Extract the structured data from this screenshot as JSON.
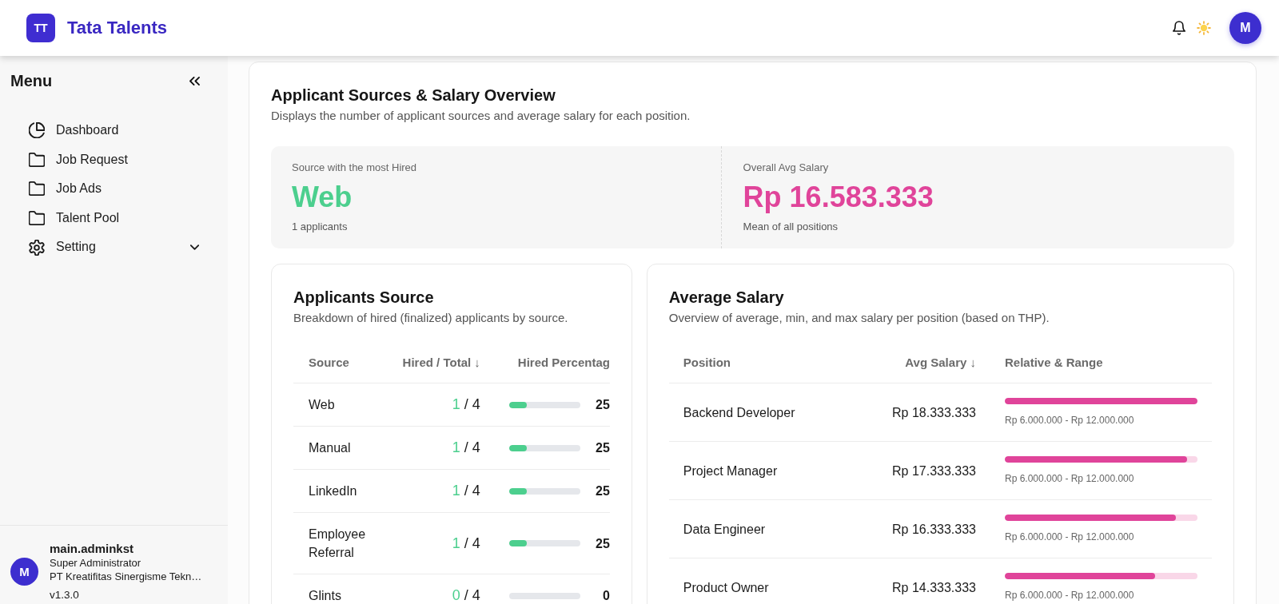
{
  "header": {
    "logo_text": "TT",
    "app_name": "Tata Talents",
    "avatar_initial": "M"
  },
  "sidebar": {
    "title": "Menu",
    "items": [
      {
        "label": "Dashboard",
        "kind": "overview",
        "selected": false
      },
      {
        "label": "Job Request",
        "kind": "page",
        "selected": false
      },
      {
        "label": "Job Ads",
        "kind": "page",
        "selected": false
      },
      {
        "label": "Talent Pool",
        "kind": "page",
        "selected": false
      },
      {
        "label": "Setting",
        "kind": "group",
        "selected": false,
        "expanded": false
      }
    ],
    "user": {
      "avatar_initial": "M",
      "name": "main.adminkst",
      "role": "Super Administrator",
      "company": "PT Kreatifitas Sinergisme Tekn…",
      "version": "v1.3.0"
    }
  },
  "overview": {
    "title": "Applicant Sources & Salary Overview",
    "subtitle": "Displays the number of applicant sources and average salary for each position.",
    "stats": [
      {
        "label": "Source with the most Hired",
        "value": "Web",
        "note": "1 applicants",
        "color": "#4ccf8e"
      },
      {
        "label": "Overall Avg Salary",
        "value": "Rp 16.583.333",
        "note": "Mean of all positions",
        "color": "#e0449a"
      }
    ]
  },
  "applicants_source": {
    "title": "Applicants Source",
    "subtitle": "Breakdown of hired (finalized) applicants by source.",
    "columns": [
      "Source",
      "Hired / Total ↓",
      "Hired Percentag"
    ],
    "rows": [
      {
        "source": "Web",
        "hired": "1",
        "total": "/ 4",
        "level": 0.25,
        "percentage": "25"
      },
      {
        "source": "Manual",
        "hired": "1",
        "total": "/ 4",
        "level": 0.25,
        "percentage": "25"
      },
      {
        "source": "LinkedIn",
        "hired": "1",
        "total": "/ 4",
        "level": 0.25,
        "percentage": "25"
      },
      {
        "source": "Employee Referral",
        "hired": "1",
        "total": "/ 4",
        "level": 0.25,
        "percentage": "25"
      },
      {
        "source": "Glints",
        "hired": "0",
        "total": "/ 4",
        "level": 0,
        "percentage": "0"
      }
    ]
  },
  "average_salary": {
    "title": "Average Salary",
    "subtitle": "Overview of average, min, and max salary per position (based on THP).",
    "columns": [
      "Position",
      "Avg Salary ↓",
      "Relative & Range"
    ],
    "rows": [
      {
        "position": "Backend Developer",
        "avg_salary": "Rp 18.333.333",
        "level": 1,
        "range": "Rp 6.000.000 - Rp 12.000.000"
      },
      {
        "position": "Project Manager",
        "avg_salary": "Rp 17.333.333",
        "level": 0.945,
        "range": "Rp 6.000.000 - Rp 12.000.000"
      },
      {
        "position": "Data Engineer",
        "avg_salary": "Rp 16.333.333",
        "level": 0.89,
        "range": "Rp 6.000.000 - Rp 12.000.000"
      },
      {
        "position": "Product Owner",
        "avg_salary": "Rp 14.333.333",
        "level": 0.78,
        "range": "Rp 6.000.000 - Rp 12.000.000"
      }
    ]
  }
}
